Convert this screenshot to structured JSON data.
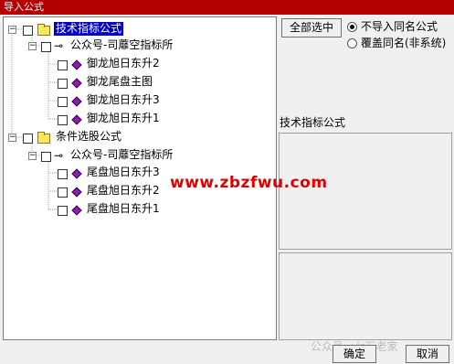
{
  "window": {
    "title": "导入公式"
  },
  "tree": {
    "groups": [
      {
        "label": "技术指标公式",
        "sub": {
          "label": "公众号-司蘼空指标所",
          "items": [
            "御龙旭日东升2",
            "御龙尾盘主图",
            "御龙旭日东升3",
            "御龙旭日东升1"
          ]
        }
      },
      {
        "label": "条件选股公式",
        "sub": {
          "label": "公众号-司蘼空指标所",
          "items": [
            "尾盘旭日东升3",
            "尾盘旭日东升2",
            "尾盘旭日东升1"
          ]
        }
      }
    ],
    "expander_symbol": "−",
    "key_symbol": "⊸"
  },
  "side": {
    "select_all_label": "全部选中",
    "radio_options": [
      {
        "label": "不导入同名公式",
        "selected": true
      },
      {
        "label": "覆盖同名(非系统)",
        "selected": false
      }
    ],
    "category_label": "技术指标公式"
  },
  "footer": {
    "ok_label": "确定",
    "cancel_label": "取消"
  },
  "watermark": "www.zbzfwu.com",
  "wechat_mark": "公众号 · 七万老家",
  "colors": {
    "title_bar": "#b40000",
    "selection": "#0000c8",
    "watermark": "#e00000",
    "gem": "#8b1fa8"
  }
}
